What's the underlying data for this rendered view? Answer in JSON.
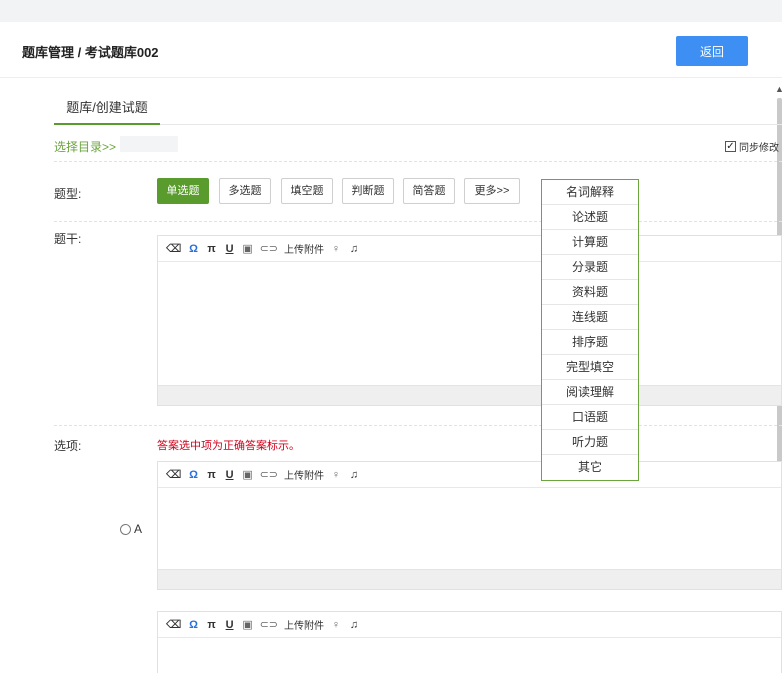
{
  "header": {
    "breadcrumb": "题库管理 / 考试题库002",
    "back_label": "返回"
  },
  "tab": {
    "label": "题库/创建试题"
  },
  "directory": {
    "select_label": "选择目录>>",
    "sync_label": "同步修改",
    "sync_checked": true
  },
  "question_type": {
    "label": "题型:",
    "buttons": [
      "单选题",
      "多选题",
      "填空题",
      "判断题",
      "简答题",
      "更多>>"
    ],
    "active": "单选题",
    "more_menu": [
      "名词解释",
      "论述题",
      "计算题",
      "分录题",
      "资料题",
      "连线题",
      "排序题",
      "完型填空",
      "阅读理解",
      "口语题",
      "听力题",
      "其它"
    ]
  },
  "stem": {
    "label": "题干:"
  },
  "options": {
    "label": "选项:",
    "hint": "答案选中项为正确答案标示。",
    "option_a": "A"
  },
  "toolbar": {
    "upload_label": "上传附件"
  },
  "colors": {
    "accent_green": "#5a9b2e",
    "primary_blue": "#3d8ff3",
    "hint_red": "#d0021b"
  }
}
